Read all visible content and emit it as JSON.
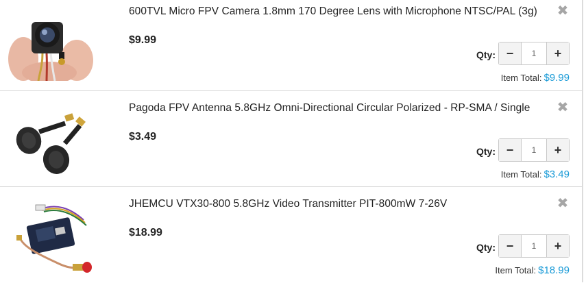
{
  "cart": {
    "qty_label": "Qty:",
    "item_total_label": "Item Total:",
    "remove_symbol": "✖",
    "minus_symbol": "−",
    "plus_symbol": "+",
    "accent_color": "#1b9bd7",
    "items": [
      {
        "title": "600TVL Micro FPV Camera 1.8mm 170 Degree Lens with Microphone NTSC/PAL (3g)",
        "price": "$9.99",
        "qty": "1",
        "item_total": "$9.99",
        "image": "micro-fpv-camera-photo"
      },
      {
        "title": "Pagoda FPV Antenna 5.8GHz Omni-Directional Circular Polarized - RP-SMA / Single",
        "price": "$3.49",
        "qty": "1",
        "item_total": "$3.49",
        "image": "pagoda-antenna-photo"
      },
      {
        "title": "JHEMCU VTX30-800 5.8GHz Video Transmitter PIT-800mW 7-26V",
        "price": "$18.99",
        "qty": "1",
        "item_total": "$18.99",
        "image": "video-transmitter-photo"
      }
    ]
  }
}
